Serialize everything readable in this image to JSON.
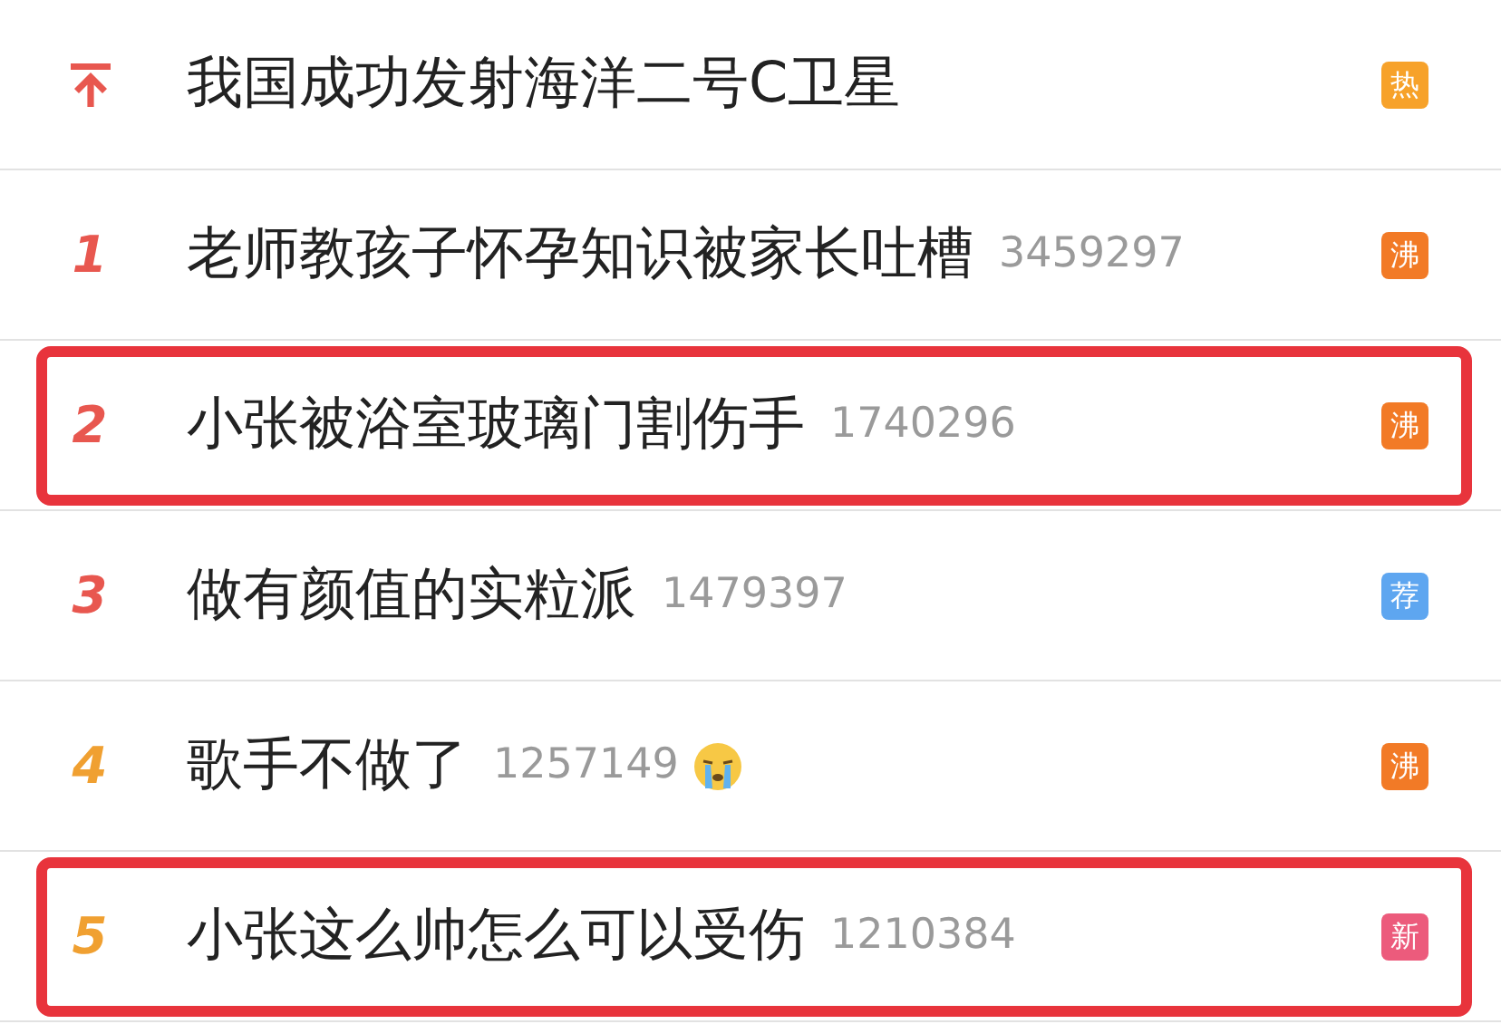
{
  "items": [
    {
      "kind": "pinned",
      "color": "#e8574f",
      "title": "我国成功发射海洋二号C卫星",
      "has_emoji": false,
      "badge": {
        "text": "热",
        "color": "#f7a22a"
      },
      "highlighted": false
    },
    {
      "kind": "ranked",
      "rank": "1",
      "color": "#e8574f",
      "title": "老师教孩子怀孕知识被家长吐槽",
      "count": "3459297",
      "has_emoji": false,
      "badge": {
        "text": "沸",
        "color": "#f27a26"
      },
      "highlighted": false
    },
    {
      "kind": "ranked",
      "rank": "2",
      "color": "#e8574f",
      "title": "小张被浴室玻璃门割伤手",
      "count": "1740296",
      "has_emoji": false,
      "badge": {
        "text": "沸",
        "color": "#f27a26"
      },
      "highlighted": true
    },
    {
      "kind": "ranked",
      "rank": "3",
      "color": "#e8574f",
      "title": "做有颜值的实粒派",
      "count": "1479397",
      "has_emoji": false,
      "badge": {
        "text": "荐",
        "color": "#5ea6f0"
      },
      "highlighted": false
    },
    {
      "kind": "ranked",
      "rank": "4",
      "color": "#f0a031",
      "title": "歌手不做了",
      "count": "1257149",
      "has_emoji": true,
      "badge": {
        "text": "沸",
        "color": "#f27a26"
      },
      "highlighted": false
    },
    {
      "kind": "ranked",
      "rank": "5",
      "color": "#f0a031",
      "title": "小张这么帅怎么可以受伤",
      "count": "1210384",
      "has_emoji": false,
      "badge": {
        "text": "新",
        "color": "#ec5b7c"
      },
      "highlighted": true
    }
  ]
}
